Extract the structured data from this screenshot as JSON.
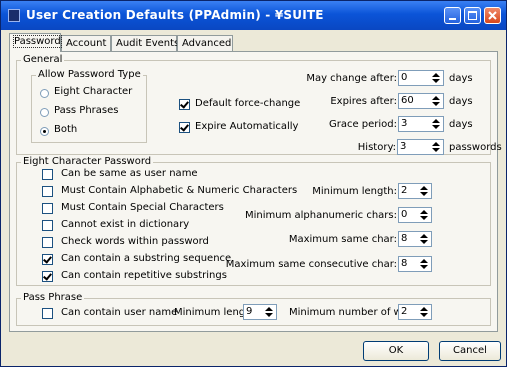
{
  "window": {
    "title": "User Creation Defaults (PPAdmin) - ¥SUITE"
  },
  "tabs": [
    "Password",
    "Account",
    "Audit Events",
    "Advanced"
  ],
  "general": {
    "legend": "General",
    "allow_type": {
      "legend": "Allow Password Type",
      "options": [
        "Eight Character",
        "Pass Phrases",
        "Both"
      ],
      "selected": "Both"
    },
    "default_force_change": {
      "label": "Default force-change",
      "checked": true
    },
    "expire_automatically": {
      "label": "Expire Automatically",
      "checked": true
    },
    "may_change_after": {
      "label": "May change after:",
      "value": "0",
      "unit": "days"
    },
    "expires_after": {
      "label": "Expires after:",
      "value": "60",
      "unit": "days"
    },
    "grace_period": {
      "label": "Grace period:",
      "value": "3",
      "unit": "days"
    },
    "history": {
      "label": "History:",
      "value": "3",
      "unit": "passwords"
    }
  },
  "eight_char": {
    "legend": "Eight Character Password",
    "options": [
      {
        "label": "Can be same as user name",
        "checked": false
      },
      {
        "label": "Must Contain Alphabetic & Numeric Characters",
        "checked": false
      },
      {
        "label": "Must Contain Special Characters",
        "checked": false
      },
      {
        "label": "Cannot exist in dictionary",
        "checked": false
      },
      {
        "label": "Check words within password",
        "checked": false
      },
      {
        "label": "Can contain a substring sequence",
        "checked": true
      },
      {
        "label": "Can contain repetitive substrings",
        "checked": true
      }
    ],
    "min_length": {
      "label": "Minimum length:",
      "value": "2"
    },
    "min_alnum": {
      "label": "Minimum alphanumeric chars:",
      "value": "0"
    },
    "max_same": {
      "label": "Maximum same char:",
      "value": "8"
    },
    "max_same_consec": {
      "label": "Maximum same consecutive char:",
      "value": "8"
    }
  },
  "pass_phrase": {
    "legend": "Pass Phrase",
    "can_contain_user": {
      "label": "Can contain user name",
      "checked": false
    },
    "min_length": {
      "label": "Minimum length:",
      "value": "9"
    },
    "min_words": {
      "label": "Minimum number of words",
      "value": "2"
    }
  },
  "buttons": {
    "ok": "OK",
    "cancel": "Cancel"
  }
}
